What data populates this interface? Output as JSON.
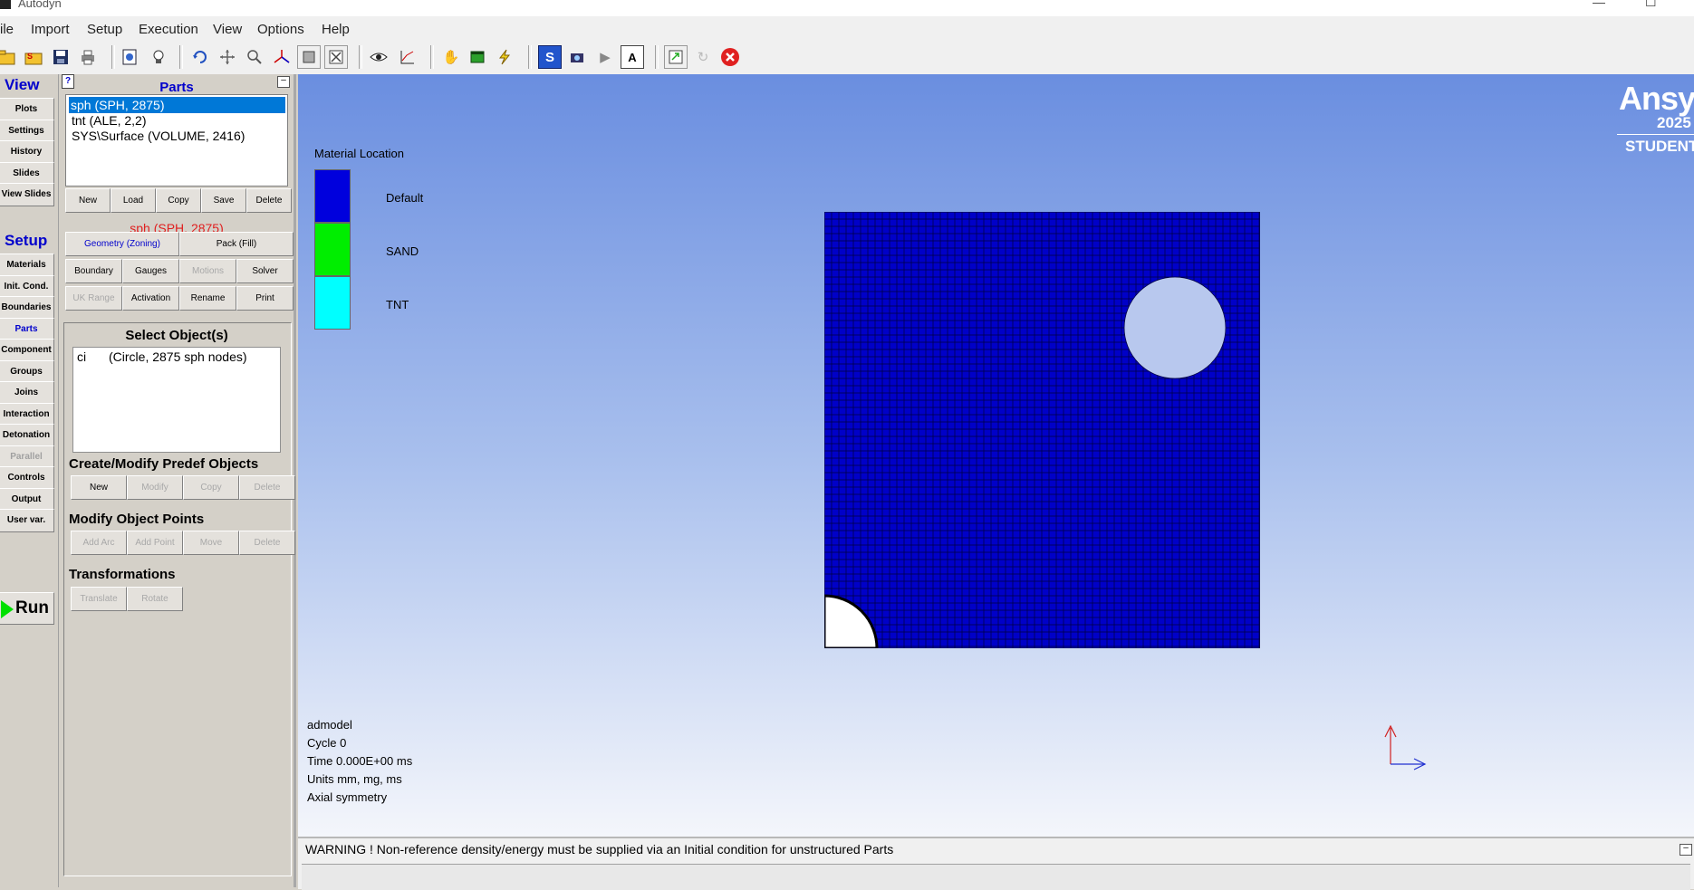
{
  "window": {
    "title": "Autodyn"
  },
  "menu": {
    "items": [
      "ile",
      "Import",
      "Setup",
      "Execution",
      "View",
      "Options",
      "Help"
    ]
  },
  "toolbar": {
    "icons": [
      "open-folder-icon",
      "open-sph-icon",
      "save-icon",
      "print-icon",
      "model-info-icon",
      "lightbulb-icon",
      "refresh-icon",
      "pan-icon",
      "zoom-icon",
      "axes-icon",
      "fit-view-icon",
      "fit-all-icon",
      "eye-icon",
      "axis-plot-icon",
      "hand-icon",
      "green-box-icon",
      "lightning-icon",
      "s-icon",
      "camera-icon",
      "record-icon",
      "text-a-icon",
      "export-icon",
      "reload-icon",
      "close-red-icon"
    ]
  },
  "nav": {
    "view_header": "View",
    "view_items": [
      "Plots",
      "Settings",
      "History",
      "Slides",
      "View Slides"
    ],
    "setup_header": "Setup",
    "setup_items": [
      "Materials",
      "Init. Cond.",
      "Boundaries",
      "Parts",
      "Component",
      "Groups",
      "Joins",
      "Interaction",
      "Detonation",
      "Parallel",
      "Controls",
      "Output",
      "User var."
    ],
    "active": "Parts",
    "disabled": [
      "Parallel"
    ],
    "run_label": "Run"
  },
  "parts": {
    "help": "?",
    "minimize": "–",
    "title": "Parts",
    "list": [
      "sph (SPH, 2875)",
      "tnt (ALE, 2,2)",
      "SYS\\Surface (VOLUME, 2416)"
    ],
    "selected_index": 0,
    "buttons": [
      "New",
      "Load",
      "Copy",
      "Save",
      "Delete"
    ],
    "current_part": "sph (SPH, 2875)",
    "tabs": [
      "Geometry (Zoning)",
      "Pack (Fill)"
    ],
    "actions_row1": [
      "Boundary",
      "Gauges",
      "Motions",
      "Solver"
    ],
    "actions_row2": [
      "UK Range",
      "Activation",
      "Rename",
      "Print"
    ],
    "select_title": "Select Object(s)",
    "objects": [
      {
        "name": "ci",
        "desc": "(Circle, 2875 sph nodes)"
      }
    ],
    "predef_title": "Create/Modify Predef Objects",
    "predef_buttons": [
      "New",
      "Modify",
      "Copy",
      "Delete"
    ],
    "points_title": "Modify Object Points",
    "points_buttons": [
      "Add Arc",
      "Add Point",
      "Move",
      "Delete"
    ],
    "transform_title": "Transformations",
    "transform_buttons": [
      "Translate",
      "Rotate"
    ]
  },
  "viewport": {
    "legend_title": "Material Location",
    "legend": [
      {
        "label": "Default",
        "color": "#0000dd"
      },
      {
        "label": "SAND",
        "color": "#00ee00"
      },
      {
        "label": "TNT",
        "color": "#00ffff"
      }
    ],
    "info": [
      "admodel",
      "Cycle 0",
      "Time 0.000E+00 ms",
      "Units mm, mg, ms",
      "Axial symmetry"
    ],
    "logo": {
      "brand": "Ansy",
      "year": "2025",
      "edition": "STUDENT"
    },
    "mesh_color": "#0000c8"
  },
  "status": {
    "message": "WARNING ! Non-reference density/energy must be supplied via an Initial condition for unstructured Parts"
  }
}
